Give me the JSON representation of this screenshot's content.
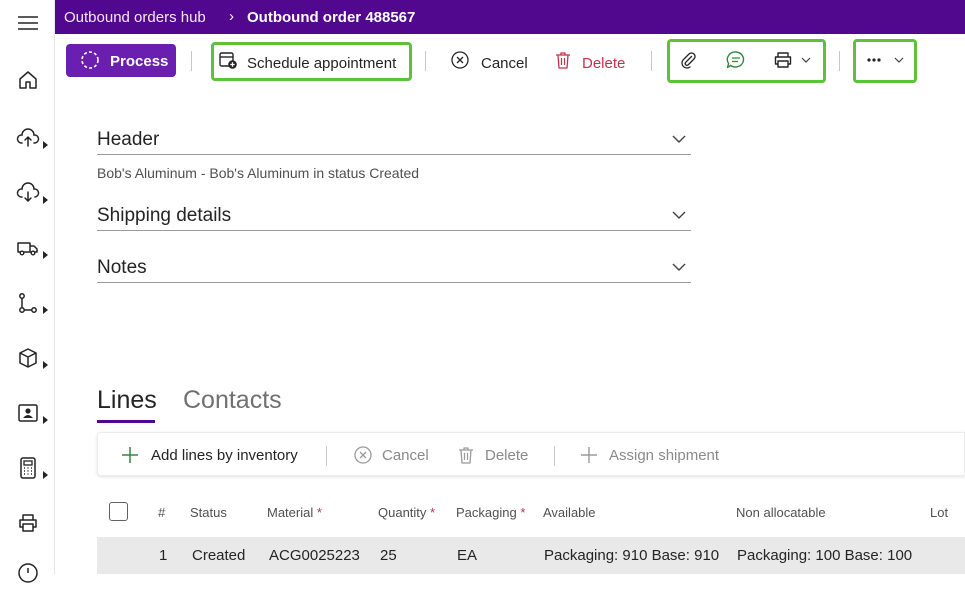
{
  "breadcrumb": {
    "parent": "Outbound orders hub",
    "separator": "›",
    "current": "Outbound order 488567"
  },
  "nav_rail": {
    "items": [
      {
        "icon": "menu-icon"
      },
      {
        "icon": "home-icon"
      },
      {
        "icon": "upload-icon"
      },
      {
        "icon": "download-icon"
      },
      {
        "icon": "truck-icon"
      },
      {
        "icon": "flow-icon"
      },
      {
        "icon": "box-icon"
      },
      {
        "icon": "contact-card-icon"
      },
      {
        "icon": "calculator-icon"
      },
      {
        "icon": "printer-icon"
      },
      {
        "icon": "clock-icon"
      }
    ]
  },
  "toolbar": {
    "process_label": "Process",
    "schedule_label": "Schedule appointment",
    "cancel_label": "Cancel",
    "delete_label": "Delete",
    "highlight_color": "#5fc13a",
    "accent_color": "#6b1fb0",
    "delete_color": "#c4314b"
  },
  "sections": {
    "header_title": "Header",
    "header_summary": "Bob's Aluminum - Bob's Aluminum in status Created",
    "shipping_title": "Shipping details",
    "notes_title": "Notes"
  },
  "tabs": {
    "lines": "Lines",
    "contacts": "Contacts"
  },
  "lines_toolbar": {
    "add_label": "Add lines by inventory",
    "cancel_label": "Cancel",
    "delete_label": "Delete",
    "assign_label": "Assign shipment"
  },
  "grid": {
    "headers": {
      "num": "#",
      "status": "Status",
      "material": "Material",
      "quantity": "Quantity",
      "packaging": "Packaging",
      "available": "Available",
      "non_allocatable": "Non allocatable",
      "lot": "Lot"
    },
    "required_marker": "*",
    "rows": [
      {
        "num": "1",
        "status": "Created",
        "material": "ACG0025223",
        "quantity": "25",
        "packaging": "EA",
        "available": "Packaging: 910 Base: 910",
        "non_allocatable": "Packaging: 100 Base: 100"
      }
    ]
  }
}
